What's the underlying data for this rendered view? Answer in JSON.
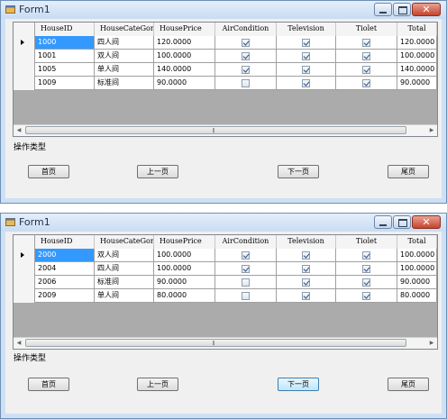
{
  "window1": {
    "title": "Form1",
    "columns": [
      "HouseID",
      "HouseCateGory",
      "HousePrice",
      "AirCondition",
      "Television",
      "Tiolet",
      "Total"
    ],
    "rows": [
      {
        "id": "1000",
        "category": "四人间",
        "price": "120.0000",
        "air": true,
        "tv": true,
        "toilet": true,
        "total": "120.0000"
      },
      {
        "id": "1001",
        "category": "双人间",
        "price": "100.0000",
        "air": true,
        "tv": true,
        "toilet": true,
        "total": "100.0000"
      },
      {
        "id": "1005",
        "category": "单人间",
        "price": "140.0000",
        "air": true,
        "tv": true,
        "toilet": true,
        "total": "140.0000"
      },
      {
        "id": "1009",
        "category": "标准间",
        "price": "90.0000",
        "air": false,
        "tv": true,
        "toilet": true,
        "total": "90.0000"
      }
    ],
    "selected_row": 0,
    "operation_label": "操作类型",
    "buttons": {
      "first": "首页",
      "prev": "上一页",
      "next": "下一页",
      "last": "尾页"
    }
  },
  "window2": {
    "title": "Form1",
    "columns": [
      "HouseID",
      "HouseCateGory",
      "HousePrice",
      "AirCondition",
      "Television",
      "Tiolet",
      "Total"
    ],
    "rows": [
      {
        "id": "2000",
        "category": "双人间",
        "price": "100.0000",
        "air": true,
        "tv": true,
        "toilet": true,
        "total": "100.0000"
      },
      {
        "id": "2004",
        "category": "四人间",
        "price": "100.0000",
        "air": true,
        "tv": true,
        "toilet": true,
        "total": "100.0000"
      },
      {
        "id": "2006",
        "category": "标准间",
        "price": "90.0000",
        "air": false,
        "tv": true,
        "toilet": true,
        "total": "90.0000"
      },
      {
        "id": "2009",
        "category": "单人间",
        "price": "80.0000",
        "air": false,
        "tv": true,
        "toilet": true,
        "total": "80.0000"
      }
    ],
    "selected_row": 0,
    "operation_label": "操作类型",
    "buttons": {
      "first": "首页",
      "prev": "上一页",
      "next": "下一页",
      "last": "尾页"
    },
    "focused_button": "next"
  },
  "icons": {
    "app": "form-app-icon",
    "minimize": "minimize-icon",
    "maximize": "maximize-icon",
    "close": "close-icon"
  },
  "colors": {
    "selection": "#3399ff",
    "titlebar": "#c9dcf2",
    "close": "#c5442c"
  }
}
